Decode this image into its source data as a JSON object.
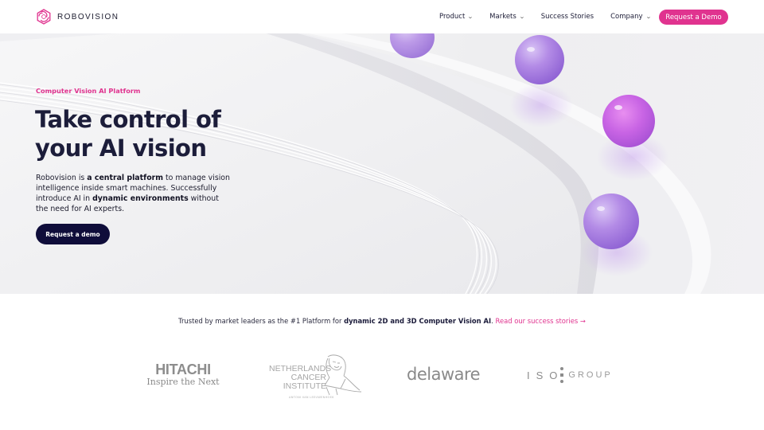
{
  "brand": {
    "name": "ROBOVISION",
    "logo_icon": "hexagon-swirl-logo",
    "accent_color": "#e0338f",
    "dark_color": "#0f0d3a"
  },
  "nav": {
    "items": [
      {
        "label": "Product",
        "has_dropdown": true
      },
      {
        "label": "Markets",
        "has_dropdown": true
      },
      {
        "label": "Success Stories",
        "has_dropdown": false
      },
      {
        "label": "Company",
        "has_dropdown": true
      }
    ],
    "chevron_icon": "chevron-down-icon",
    "cta_label": "Request a Demo"
  },
  "hero": {
    "eyebrow": "Computer Vision AI Platform",
    "title_line1": "Take control of",
    "title_line2": "your AI vision",
    "desc": {
      "p1": "Robovision is ",
      "b1": "a central platform",
      "p2": " to manage vision intelligence inside smart machines. Successfully introduce AI in ",
      "b2": "dynamic environments",
      "p3": " without the need for AI experts."
    },
    "cta_label": "Request a demo",
    "image_alt": "Abstract white track with purple spheres"
  },
  "trusted": {
    "text": "Trusted by market leaders as the #1 Platform for ",
    "bold": "dynamic 2D and 3D Computer Vision AI",
    "after": ". ",
    "link": "Read our success stories →"
  },
  "clients": {
    "hitachi": {
      "line1": "HITACHI",
      "line2": "Inspire the Next"
    },
    "nki": {
      "line1": "NETHERLANDS",
      "line2": "CANCER",
      "line3": "INSTITUTE",
      "sub": "ANTONI VAN LEEUWENHOEK"
    },
    "delaware": {
      "name": "delaware"
    },
    "isogroup": {
      "iso": "ISO",
      "group": "GROUP"
    }
  }
}
